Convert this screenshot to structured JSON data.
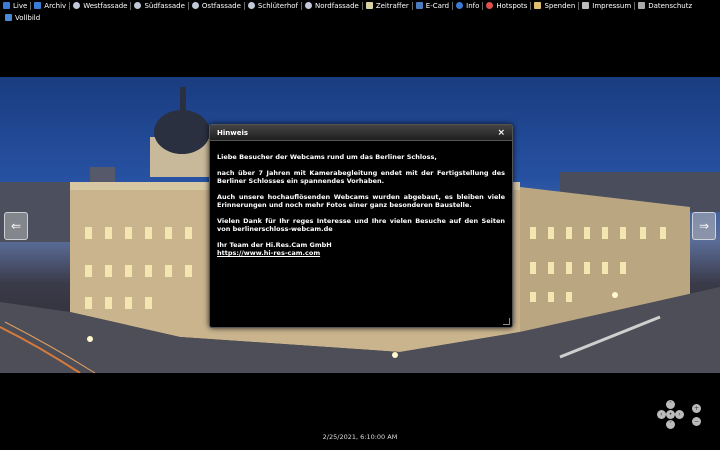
{
  "menu": {
    "items": [
      {
        "label": "Live",
        "icon": "live-icon",
        "color": "#3a7bd5"
      },
      {
        "label": "Archiv",
        "icon": "archive-icon",
        "color": "#3a7bd5"
      },
      {
        "label": "Westfassade",
        "icon": "eye-icon",
        "color": "#c0c8d8"
      },
      {
        "label": "Südfassade",
        "icon": "eye-icon",
        "color": "#c0c8d8"
      },
      {
        "label": "Ostfassade",
        "icon": "eye-icon",
        "color": "#c0c8d8"
      },
      {
        "label": "Schlüterhof",
        "icon": "eye-icon",
        "color": "#c0c8d8"
      },
      {
        "label": "Nordfassade",
        "icon": "eye-icon",
        "color": "#c0c8d8"
      },
      {
        "label": "Zeitraffer",
        "icon": "timelapse-icon",
        "color": "#d8d0a0"
      },
      {
        "label": "E-Card",
        "icon": "ecard-icon",
        "color": "#4a7cc0"
      },
      {
        "label": "Info",
        "icon": "info-icon",
        "color": "#3a7bd5"
      },
      {
        "label": "Hotspots",
        "icon": "hotspots-icon",
        "color": "#e05050"
      },
      {
        "label": "Spenden",
        "icon": "donate-icon",
        "color": "#e0c070"
      },
      {
        "label": "Impressum",
        "icon": "imprint-icon",
        "color": "#bbbbbb"
      },
      {
        "label": "Datenschutz",
        "icon": "privacy-icon",
        "color": "#aaaaaa"
      }
    ],
    "fullscreen": {
      "label": "Vollbild",
      "icon": "fullscreen-icon"
    }
  },
  "dialog": {
    "title": "Hinweis",
    "close": "×",
    "paragraphs": [
      "Liebe Besucher der Webcams rund um das Berliner Schloss,",
      "nach über 7 Jahren mit Kamerabegleitung endet mit der Fertigstellung des Berliner Schlosses ein spannendes Vorhaben.",
      "Auch unsere hochauflösenden Webcams wurden abgebaut, es bleiben viele Erinnerungen und noch mehr Fotos einer ganz besonderen Baustelle.",
      "Vielen Dank für Ihr reges Interesse und Ihre vielen Besuche auf den Seiten von berlinerschloss-webcam.de"
    ],
    "signature": "Ihr Team der Hi.Res.Cam GmbH",
    "link": "https://www.hi-res-cam.com"
  },
  "timestamp": "2/25/2021, 6:10:00 AM",
  "nav": {
    "left": "⇐",
    "right": "⇒"
  },
  "controls": {
    "up": "˄",
    "down": "˅",
    "left": "‹",
    "right": "›",
    "center": "•",
    "zoom_in": "+",
    "zoom_out": "−"
  }
}
